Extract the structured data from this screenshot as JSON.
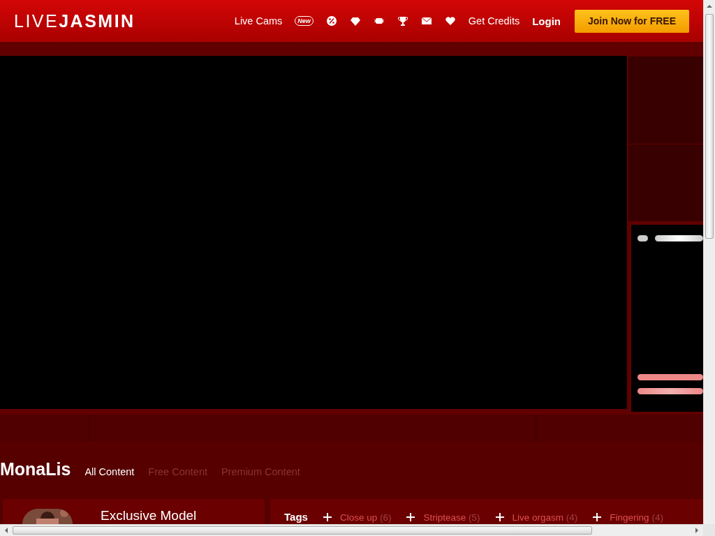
{
  "header": {
    "logo_light": "LIVE",
    "logo_bold": "JASMIN",
    "nav_link": "Live Cams",
    "new_badge": "New",
    "credits_link": "Get Credits",
    "login_link": "Login",
    "join_button": "Join Now for FREE"
  },
  "content_header": {
    "model_name": "MonaLis",
    "tabs": [
      {
        "label": "All Content",
        "selected": true
      },
      {
        "label": "Free Content",
        "selected": false
      },
      {
        "label": "Premium Content",
        "selected": false
      }
    ]
  },
  "profile": {
    "badge": "Exclusive Model",
    "tags_label": "Tags",
    "tags": [
      {
        "name": "Close up",
        "count": "(6)"
      },
      {
        "name": "Striptease",
        "count": "(5)"
      },
      {
        "name": "Live orgasm",
        "count": "(4)"
      },
      {
        "name": "Fingering",
        "count": "(4)"
      }
    ]
  }
}
